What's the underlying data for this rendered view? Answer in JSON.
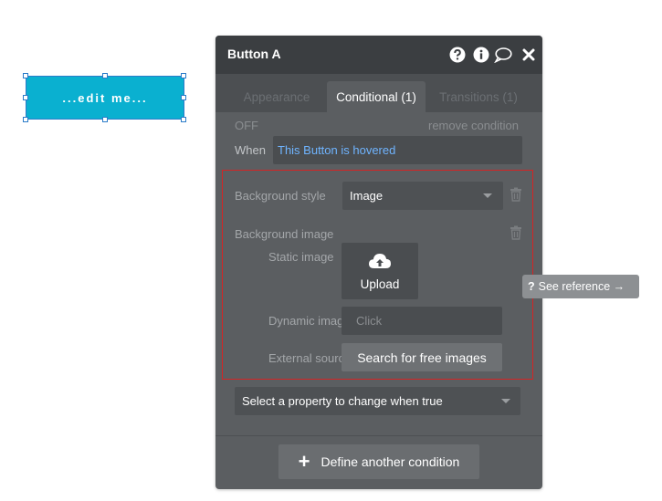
{
  "canvas": {
    "button_text": "...edit me..."
  },
  "panel": {
    "title": "Button A",
    "header_icons": [
      "help-icon",
      "info-icon",
      "comment-icon",
      "close-icon"
    ],
    "tabs": [
      {
        "label": "Appearance",
        "active": false
      },
      {
        "label": "Conditional (1)",
        "active": true
      },
      {
        "label": "Transitions (1)",
        "active": false
      }
    ],
    "condition": {
      "off_label": "OFF",
      "remove_label": "remove condition",
      "when_label": "When",
      "expression": "This Button is hovered"
    },
    "properties": {
      "background_style_label": "Background style",
      "background_style_value": "Image",
      "background_image_label": "Background image",
      "static_image_label": "Static image",
      "upload_label": "Upload",
      "dynamic_image_label": "Dynamic imag",
      "dynamic_image_placeholder": "Click",
      "external_source_label": "External sourc",
      "search_images_label": "Search for free images"
    },
    "select_property_label": "Select a property to change when true",
    "define_condition_label": "Define another condition"
  },
  "tooltip": {
    "see_reference_label": "See reference →"
  },
  "colors": {
    "accent_blue": "#6fb4ff",
    "highlight_red": "#d42525",
    "canvas_button": "#0ab0d0"
  }
}
